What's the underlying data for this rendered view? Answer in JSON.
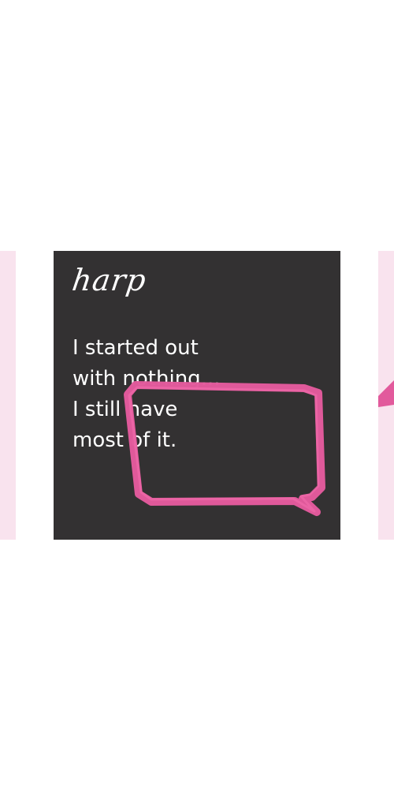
{
  "card": {
    "logo": "harp",
    "quote_lines": [
      "I started out",
      "with nothing...",
      "I still have",
      "most of it."
    ]
  },
  "colors": {
    "card_background": "#333132",
    "accent": "#e25a9c",
    "peek_background": "#f9e3ee",
    "text": "#ffffff"
  },
  "icons": {
    "bubble": "speech-bubble-icon"
  }
}
